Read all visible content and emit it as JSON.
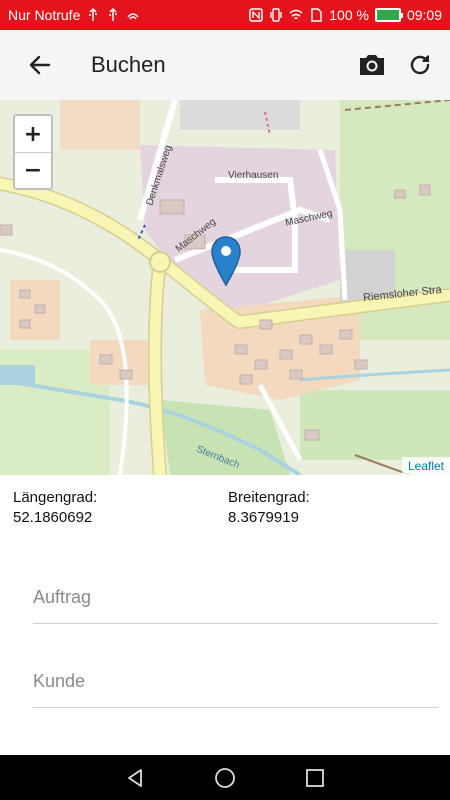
{
  "status_bar": {
    "carrier": "Nur Notrufe",
    "battery_percent": "100 %",
    "time": "09:09"
  },
  "app_bar": {
    "title": "Buchen",
    "back_icon": "arrow-back-icon",
    "camera_icon": "camera-icon",
    "refresh_icon": "refresh-icon"
  },
  "map": {
    "zoom_in": "+",
    "zoom_out": "−",
    "attribution": "Leaflet",
    "labels": {
      "vierhausen": "Vierhausen",
      "maschweg_1": "Maschweg",
      "maschweg_2": "Maschweg",
      "denkmalsweg": "Denkmalsweg",
      "riemsloher": "Riemsloher Stra",
      "sternbach": "Sternbach"
    }
  },
  "coordinates": {
    "longitude_label": "Längengrad:",
    "longitude_value": "52.1860692",
    "latitude_label": "Breitengrad:",
    "latitude_value": "8.3679919"
  },
  "form": {
    "auftrag_placeholder": "Auftrag",
    "kunde_placeholder": "Kunde"
  },
  "colors": {
    "status_bar": "#e3141c",
    "app_bar": "#f5f5f5",
    "marker": "#2a81cb"
  }
}
